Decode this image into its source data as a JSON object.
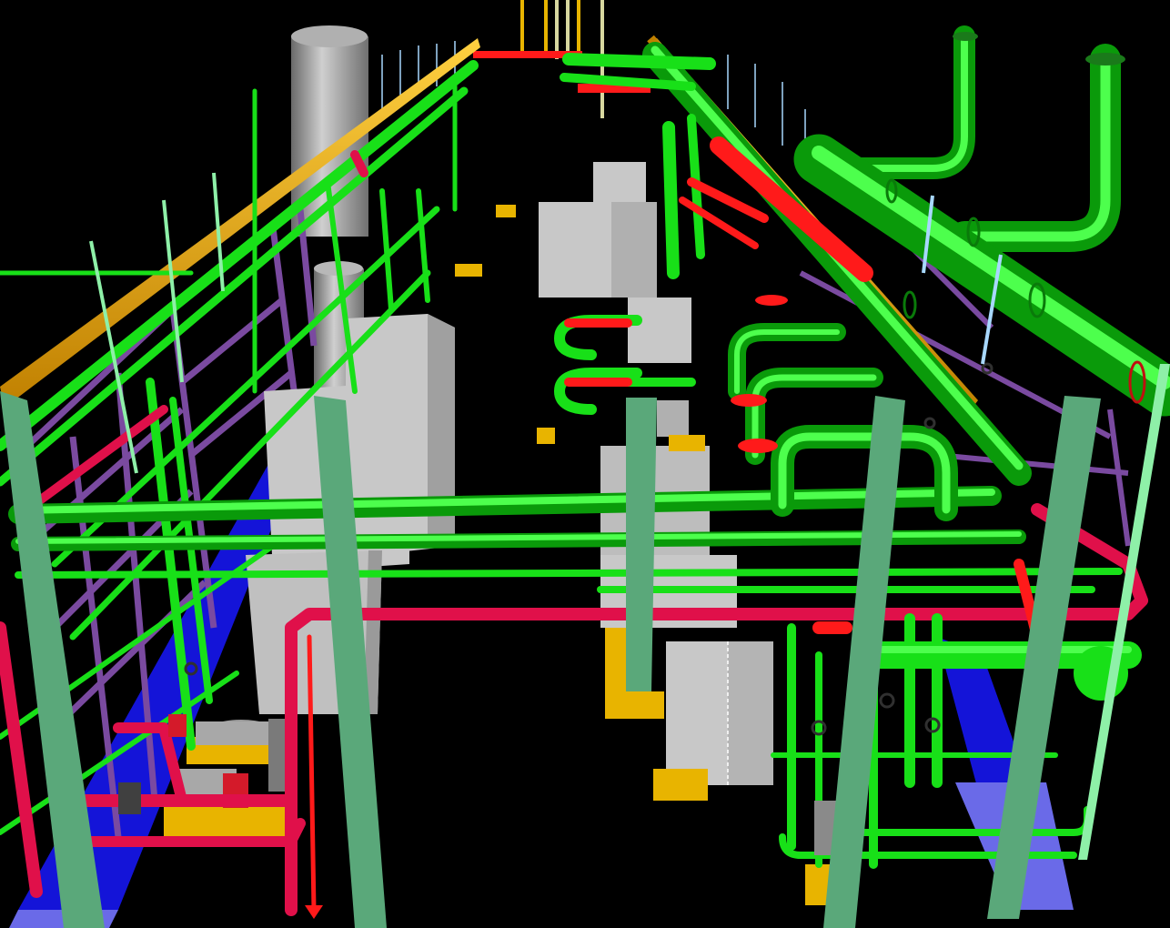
{
  "scene": {
    "caption": "",
    "colors": {
      "background": "#000000",
      "process_pipe": "#18e018",
      "process_pipe_dark": "#0a9a0a",
      "hot_pipe": "#e0104a",
      "hot_pipe_bright": "#ff1a1a",
      "cable_tray": "#f0a800",
      "column": "#5aa87a",
      "column_light": "#8ef0a8",
      "steel_frame": "#7a4aa0",
      "floor_trench": "#1414d8",
      "floor_trench_light": "#6a6ae8",
      "equipment": "#c8c8c8",
      "equipment_shade": "#a0a0a0",
      "skid_base": "#e8b400",
      "valve": "#404040",
      "instrument_line": "#a8d8ff"
    },
    "layers": [
      "process-piping",
      "hot-piping",
      "cable-trays",
      "structural-columns",
      "steel-frames",
      "equipment",
      "skids",
      "valves",
      "floor-trenches"
    ]
  }
}
